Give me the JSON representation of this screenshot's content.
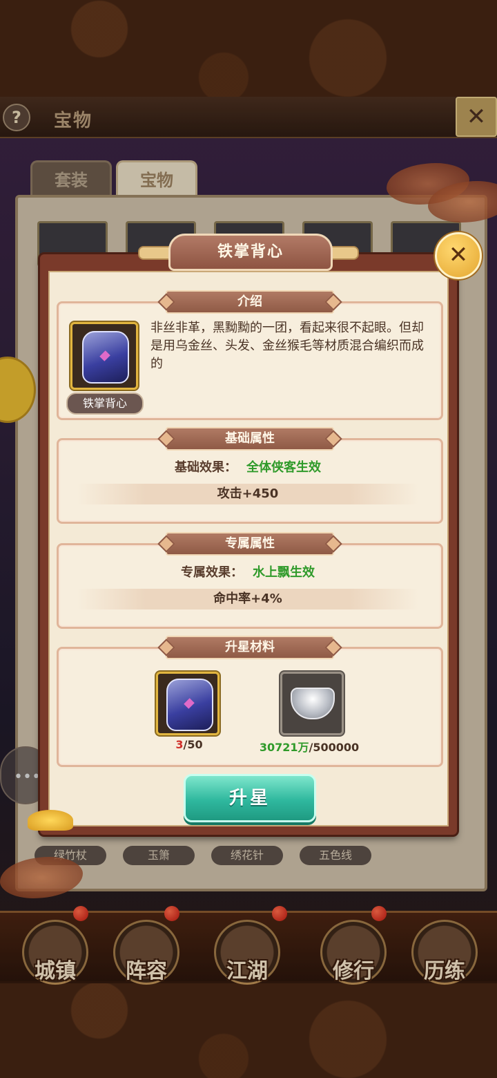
{
  "page": {
    "title": "宝物",
    "help_icon": "?",
    "close_icon": "✕",
    "tabs": [
      {
        "label": "套装",
        "active": false
      },
      {
        "label": "宝物",
        "active": true
      }
    ],
    "item_labels": [
      "绿竹杖",
      "玉箫",
      "绣花针",
      "五色线"
    ],
    "chat_icon": "•••"
  },
  "dialog": {
    "title": "铁掌背心",
    "close_icon": "✕",
    "intro": {
      "title": "介绍",
      "item_name": "铁掌背心",
      "description": "非丝非革，黑黝黝的一团，看起来很不起眼。但却是用乌金丝、头发、金丝猴毛等材质混合编织而成的"
    },
    "base_attr": {
      "title": "基础属性",
      "effect_label": "基础效果：",
      "effect_value": "全体侠客生效",
      "stat": "攻击+450"
    },
    "exclusive_attr": {
      "title": "专属属性",
      "effect_label": "专属效果：",
      "effect_value": "水上飘生效",
      "stat": "命中率+4%"
    },
    "materials": {
      "title": "升星材料",
      "items": [
        {
          "icon": "armor-icon",
          "have": "3",
          "need": "/50"
        },
        {
          "icon": "silver-ingot-icon",
          "have": "30721万",
          "need": "/500000"
        }
      ]
    },
    "star_button": "升星"
  },
  "bottom_nav": [
    {
      "label": "城镇"
    },
    {
      "label": "阵容"
    },
    {
      "label": "江湖"
    },
    {
      "label": "修行"
    },
    {
      "label": "历练"
    }
  ],
  "colors": {
    "accent_green": "#2f9a2a",
    "count_red": "#d0302a",
    "button_teal": "#2fb89e",
    "dialog_frame": "#7a3a2a"
  }
}
